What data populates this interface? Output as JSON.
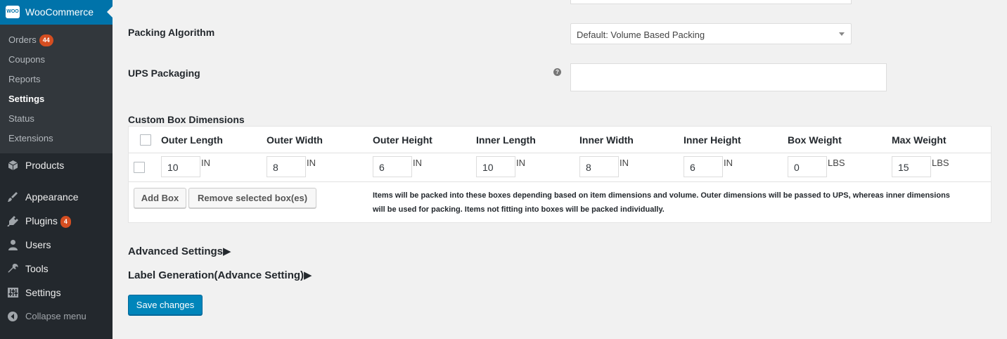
{
  "sidebar": {
    "woocommerce": {
      "logo": "WOO",
      "label": "WooCommerce"
    },
    "submenu": [
      {
        "label": "Orders",
        "badge": "44"
      },
      {
        "label": "Coupons"
      },
      {
        "label": "Reports"
      },
      {
        "label": "Settings",
        "active": true
      },
      {
        "label": "Status"
      },
      {
        "label": "Extensions"
      }
    ],
    "menu": [
      {
        "label": "Products",
        "icon": "cube-icon"
      },
      {
        "label": "Appearance",
        "icon": "paintbrush-icon"
      },
      {
        "label": "Plugins",
        "icon": "plugin-icon",
        "badge": "4"
      },
      {
        "label": "Users",
        "icon": "user-icon"
      },
      {
        "label": "Tools",
        "icon": "wrench-icon"
      },
      {
        "label": "Settings",
        "icon": "settings-sliders-icon"
      },
      {
        "label": "Collapse menu",
        "icon": "collapse-icon"
      }
    ]
  },
  "form": {
    "packing_algorithm": {
      "label": "Packing Algorithm",
      "value": "Default: Volume Based Packing"
    },
    "ups_packaging": {
      "label": "UPS Packaging",
      "help": "?"
    },
    "custom_boxes": {
      "label": "Custom Box Dimensions",
      "columns": [
        "Outer Length",
        "Outer Width",
        "Outer Height",
        "Inner Length",
        "Inner Width",
        "Inner Height",
        "Box Weight",
        "Max Weight"
      ],
      "row": [
        {
          "value": "10",
          "unit": "IN"
        },
        {
          "value": "8",
          "unit": "IN"
        },
        {
          "value": "6",
          "unit": "IN"
        },
        {
          "value": "10",
          "unit": "IN"
        },
        {
          "value": "8",
          "unit": "IN"
        },
        {
          "value": "6",
          "unit": "IN"
        },
        {
          "value": "0",
          "unit": "LBS"
        },
        {
          "value": "15",
          "unit": "LBS"
        }
      ],
      "add_button": "Add Box",
      "remove_button": "Remove selected box(es)",
      "note": "Items will be packed into these boxes depending based on item dimensions and volume. Outer dimensions will be passed to UPS, whereas inner dimensions will be used for packing. Items not fitting into boxes will be packed individually."
    },
    "advanced_settings": "Advanced Settings▶",
    "label_generation": "Label Generation(Advance Setting)▶",
    "save_button": "Save changes"
  },
  "colors": {
    "sidebar_bg": "#23282d",
    "submenu_bg": "#32373c",
    "accent": "#0073aa",
    "primary_button": "#0085ba",
    "badge": "#d54e21"
  }
}
